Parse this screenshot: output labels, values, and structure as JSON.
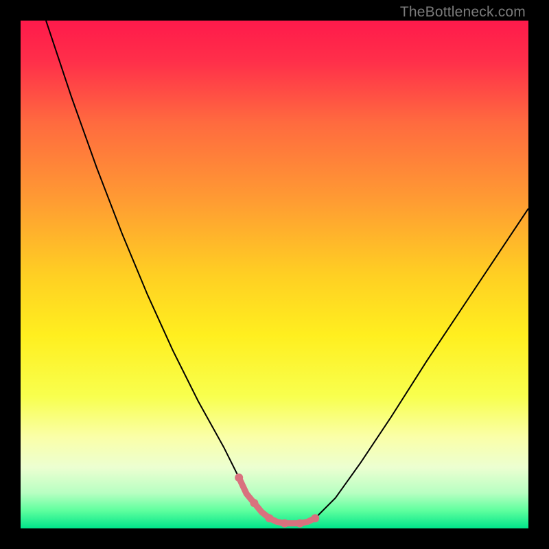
{
  "watermark": "TheBottleneck.com",
  "chart_data": {
    "type": "line",
    "title": "",
    "xlabel": "",
    "ylabel": "",
    "xlim": [
      0,
      100
    ],
    "ylim": [
      0,
      100
    ],
    "grid": false,
    "legend": false,
    "annotations": [],
    "background_gradient_stops": [
      {
        "pos": 0.0,
        "color": "#ff1a4b"
      },
      {
        "pos": 0.08,
        "color": "#ff2f4a"
      },
      {
        "pos": 0.2,
        "color": "#ff6a3f"
      },
      {
        "pos": 0.35,
        "color": "#ff9a33"
      },
      {
        "pos": 0.5,
        "color": "#ffcf23"
      },
      {
        "pos": 0.62,
        "color": "#ffef1f"
      },
      {
        "pos": 0.74,
        "color": "#f8ff4e"
      },
      {
        "pos": 0.82,
        "color": "#faffa8"
      },
      {
        "pos": 0.88,
        "color": "#ecffd1"
      },
      {
        "pos": 0.93,
        "color": "#b8ffc2"
      },
      {
        "pos": 0.965,
        "color": "#5eff9e"
      },
      {
        "pos": 1.0,
        "color": "#00e58a"
      }
    ],
    "series": [
      {
        "name": "bottleneck-curve",
        "color": "#000000",
        "width": 2,
        "x": [
          5,
          10,
          15,
          20,
          25,
          30,
          35,
          40,
          43,
          46,
          49,
          52,
          55,
          58,
          62,
          67,
          73,
          80,
          88,
          96,
          100
        ],
        "y": [
          100,
          85,
          71,
          58,
          46,
          35,
          25,
          16,
          10,
          5,
          2,
          1,
          1,
          2,
          6,
          13,
          22,
          33,
          45,
          57,
          63
        ]
      },
      {
        "name": "bottom-highlight",
        "color": "#d9717e",
        "width": 9,
        "linecap": "round",
        "x": [
          43,
          44.5,
          46,
          47.5,
          49,
          50.5,
          52,
          53.5,
          55,
          56.5,
          58
        ],
        "y": [
          10,
          6.8,
          5,
          3.2,
          2,
          1.3,
          1,
          1,
          1,
          1.3,
          2
        ]
      }
    ],
    "highlight_dots": {
      "color": "#d9717e",
      "radius": 6,
      "x": [
        43,
        46,
        49,
        52,
        55,
        58
      ],
      "y": [
        10,
        5,
        2,
        1,
        1,
        2
      ]
    }
  }
}
